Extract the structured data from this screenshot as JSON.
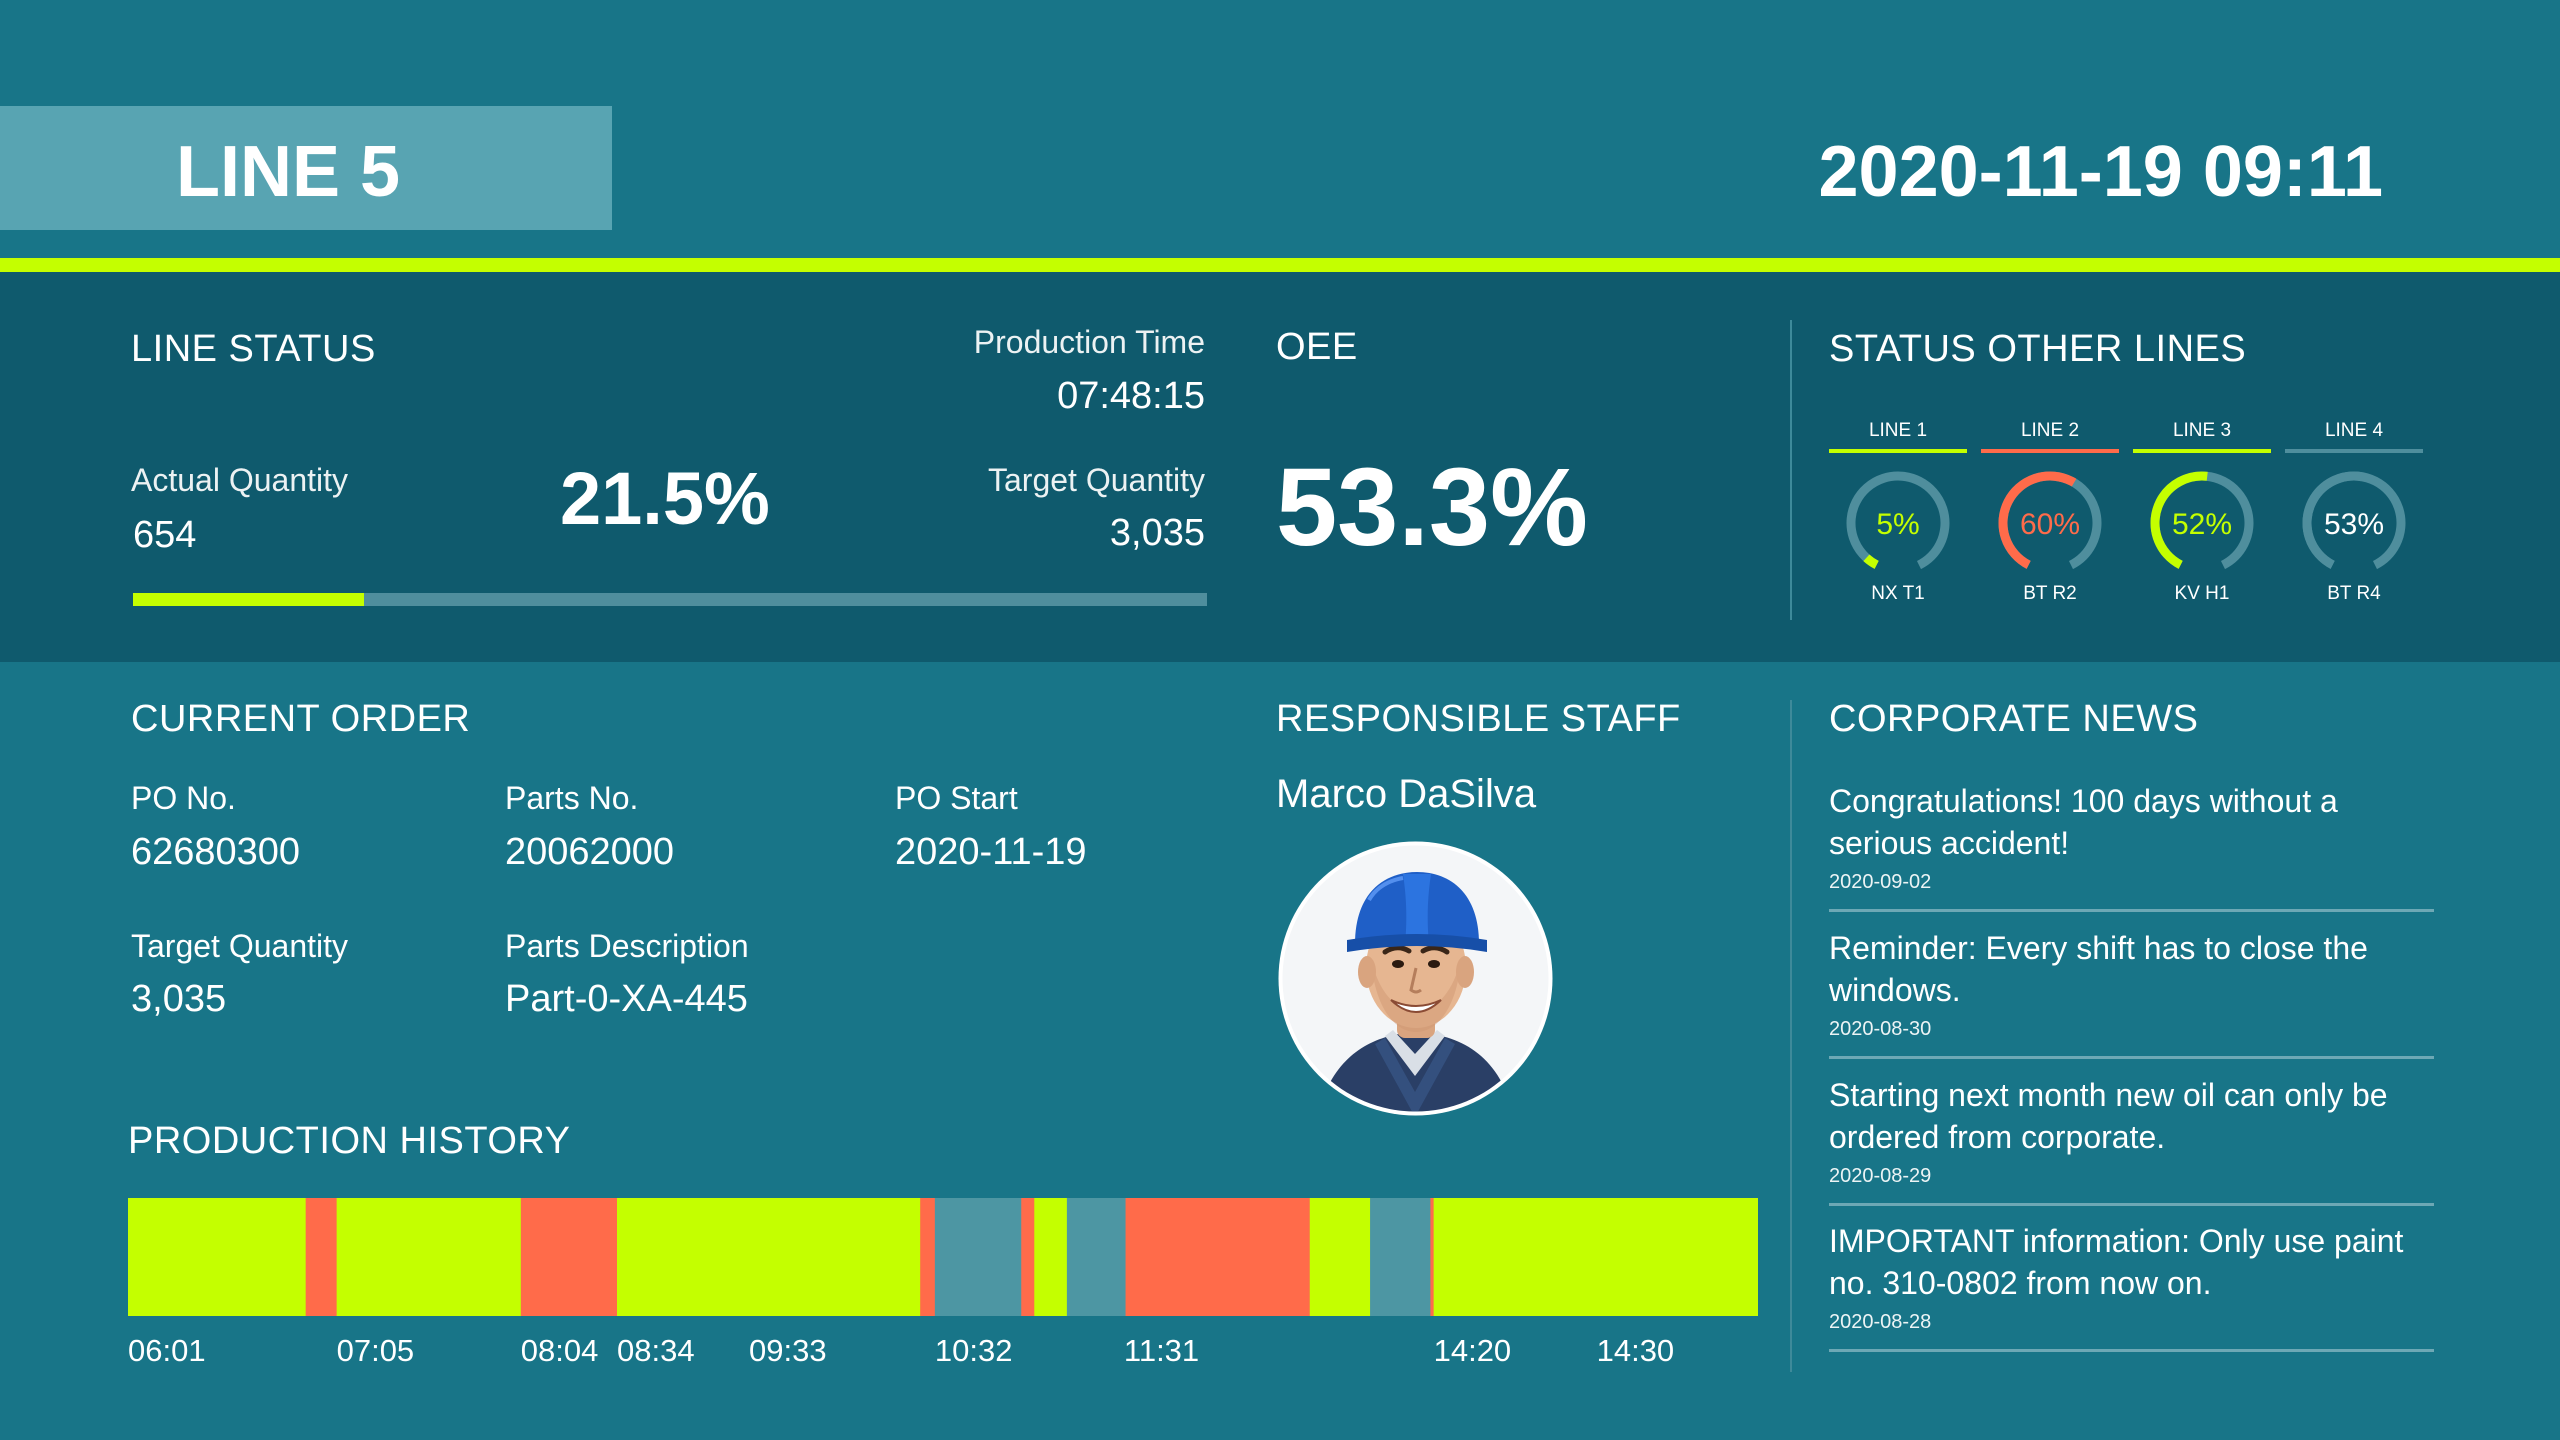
{
  "header": {
    "line_title": "LINE 5",
    "clock": "2020-11-19 09:11"
  },
  "colors": {
    "background": "#187588",
    "status_band": "#0f5a6d",
    "accent": "#c4ff00",
    "alert": "#ff6b4a",
    "idle": "#4d96a3",
    "neutral": "#4f8e9d"
  },
  "line_status": {
    "title": "LINE STATUS",
    "production_time_label": "Production Time",
    "production_time": "07:48:15",
    "actual_quantity_label": "Actual Quantity",
    "actual_quantity": "654",
    "percent": "21.5%",
    "progress_fraction": 0.215,
    "target_quantity_label": "Target Quantity",
    "target_quantity": "3,035"
  },
  "oee": {
    "title": "OEE",
    "value": "53.3%"
  },
  "other_lines": {
    "title": "STATUS OTHER LINES",
    "lines": [
      {
        "name": "LINE 1",
        "value": "5%",
        "fraction": 0.05,
        "code": "NX T1",
        "color": "#c4ff00"
      },
      {
        "name": "LINE 2",
        "value": "60%",
        "fraction": 0.6,
        "code": "BT R2",
        "color": "#ff6b4a"
      },
      {
        "name": "LINE 3",
        "value": "52%",
        "fraction": 0.52,
        "code": "KV H1",
        "color": "#c4ff00"
      },
      {
        "name": "LINE 4",
        "value": "53%",
        "fraction": 0.53,
        "code": "BT R4",
        "color": "#4f8e9d"
      }
    ]
  },
  "current_order": {
    "title": "CURRENT ORDER",
    "po_no_label": "PO No.",
    "po_no": "62680300",
    "parts_no_label": "Parts No.",
    "parts_no": "20062000",
    "po_start_label": "PO Start",
    "po_start": "2020-11-19",
    "target_quantity_label": "Target Quantity",
    "target_quantity": "3,035",
    "parts_description_label": "Parts Description",
    "parts_description": "Part-0-XA-445"
  },
  "responsible_staff": {
    "title": "RESPONSIBLE STAFF",
    "name": "Marco DaSilva"
  },
  "production_history": {
    "title": "PRODUCTION HISTORY",
    "tick_labels": [
      "06:01",
      "07:05",
      "08:04",
      "08:34",
      "09:33",
      "10:32",
      "11:31",
      "14:20",
      "14:30"
    ],
    "segments": [
      {
        "state": "running",
        "width": 0.109
      },
      {
        "state": "stopped",
        "width": 0.019
      },
      {
        "state": "running",
        "width": 0.113
      },
      {
        "state": "stopped",
        "width": 0.059
      },
      {
        "state": "running",
        "width": 0.081
      },
      {
        "state": "running",
        "width": 0.105
      },
      {
        "state": "stopped",
        "width": 0.009
      },
      {
        "state": "idle",
        "width": 0.053
      },
      {
        "state": "stopped",
        "width": 0.008
      },
      {
        "state": "running",
        "width": 0.02
      },
      {
        "state": "idle",
        "width": 0.036
      },
      {
        "state": "stopped",
        "width": 0.113
      },
      {
        "state": "running",
        "width": 0.037
      },
      {
        "state": "idle",
        "width": 0.037
      },
      {
        "state": "stopped",
        "width": 0.002
      },
      {
        "state": "running",
        "width": 0.1
      },
      {
        "state": "running",
        "width": 0.099
      }
    ],
    "tick_fractions": [
      0.0,
      0.128,
      0.241,
      0.3,
      0.381,
      0.495,
      0.611,
      0.801,
      0.901
    ]
  },
  "news": {
    "title": "CORPORATE NEWS",
    "items": [
      {
        "text": "Congratulations! 100 days without a serious accident!",
        "date": "2020-09-02"
      },
      {
        "text": "Reminder: Every shift has to close the windows.",
        "date": "2020-08-30"
      },
      {
        "text": "Starting next month new oil can only be ordered from corporate.",
        "date": "2020-08-29"
      },
      {
        "text": "IMPORTANT information: Only use paint no. 310-0802 from now on.",
        "date": "2020-08-28"
      }
    ]
  }
}
